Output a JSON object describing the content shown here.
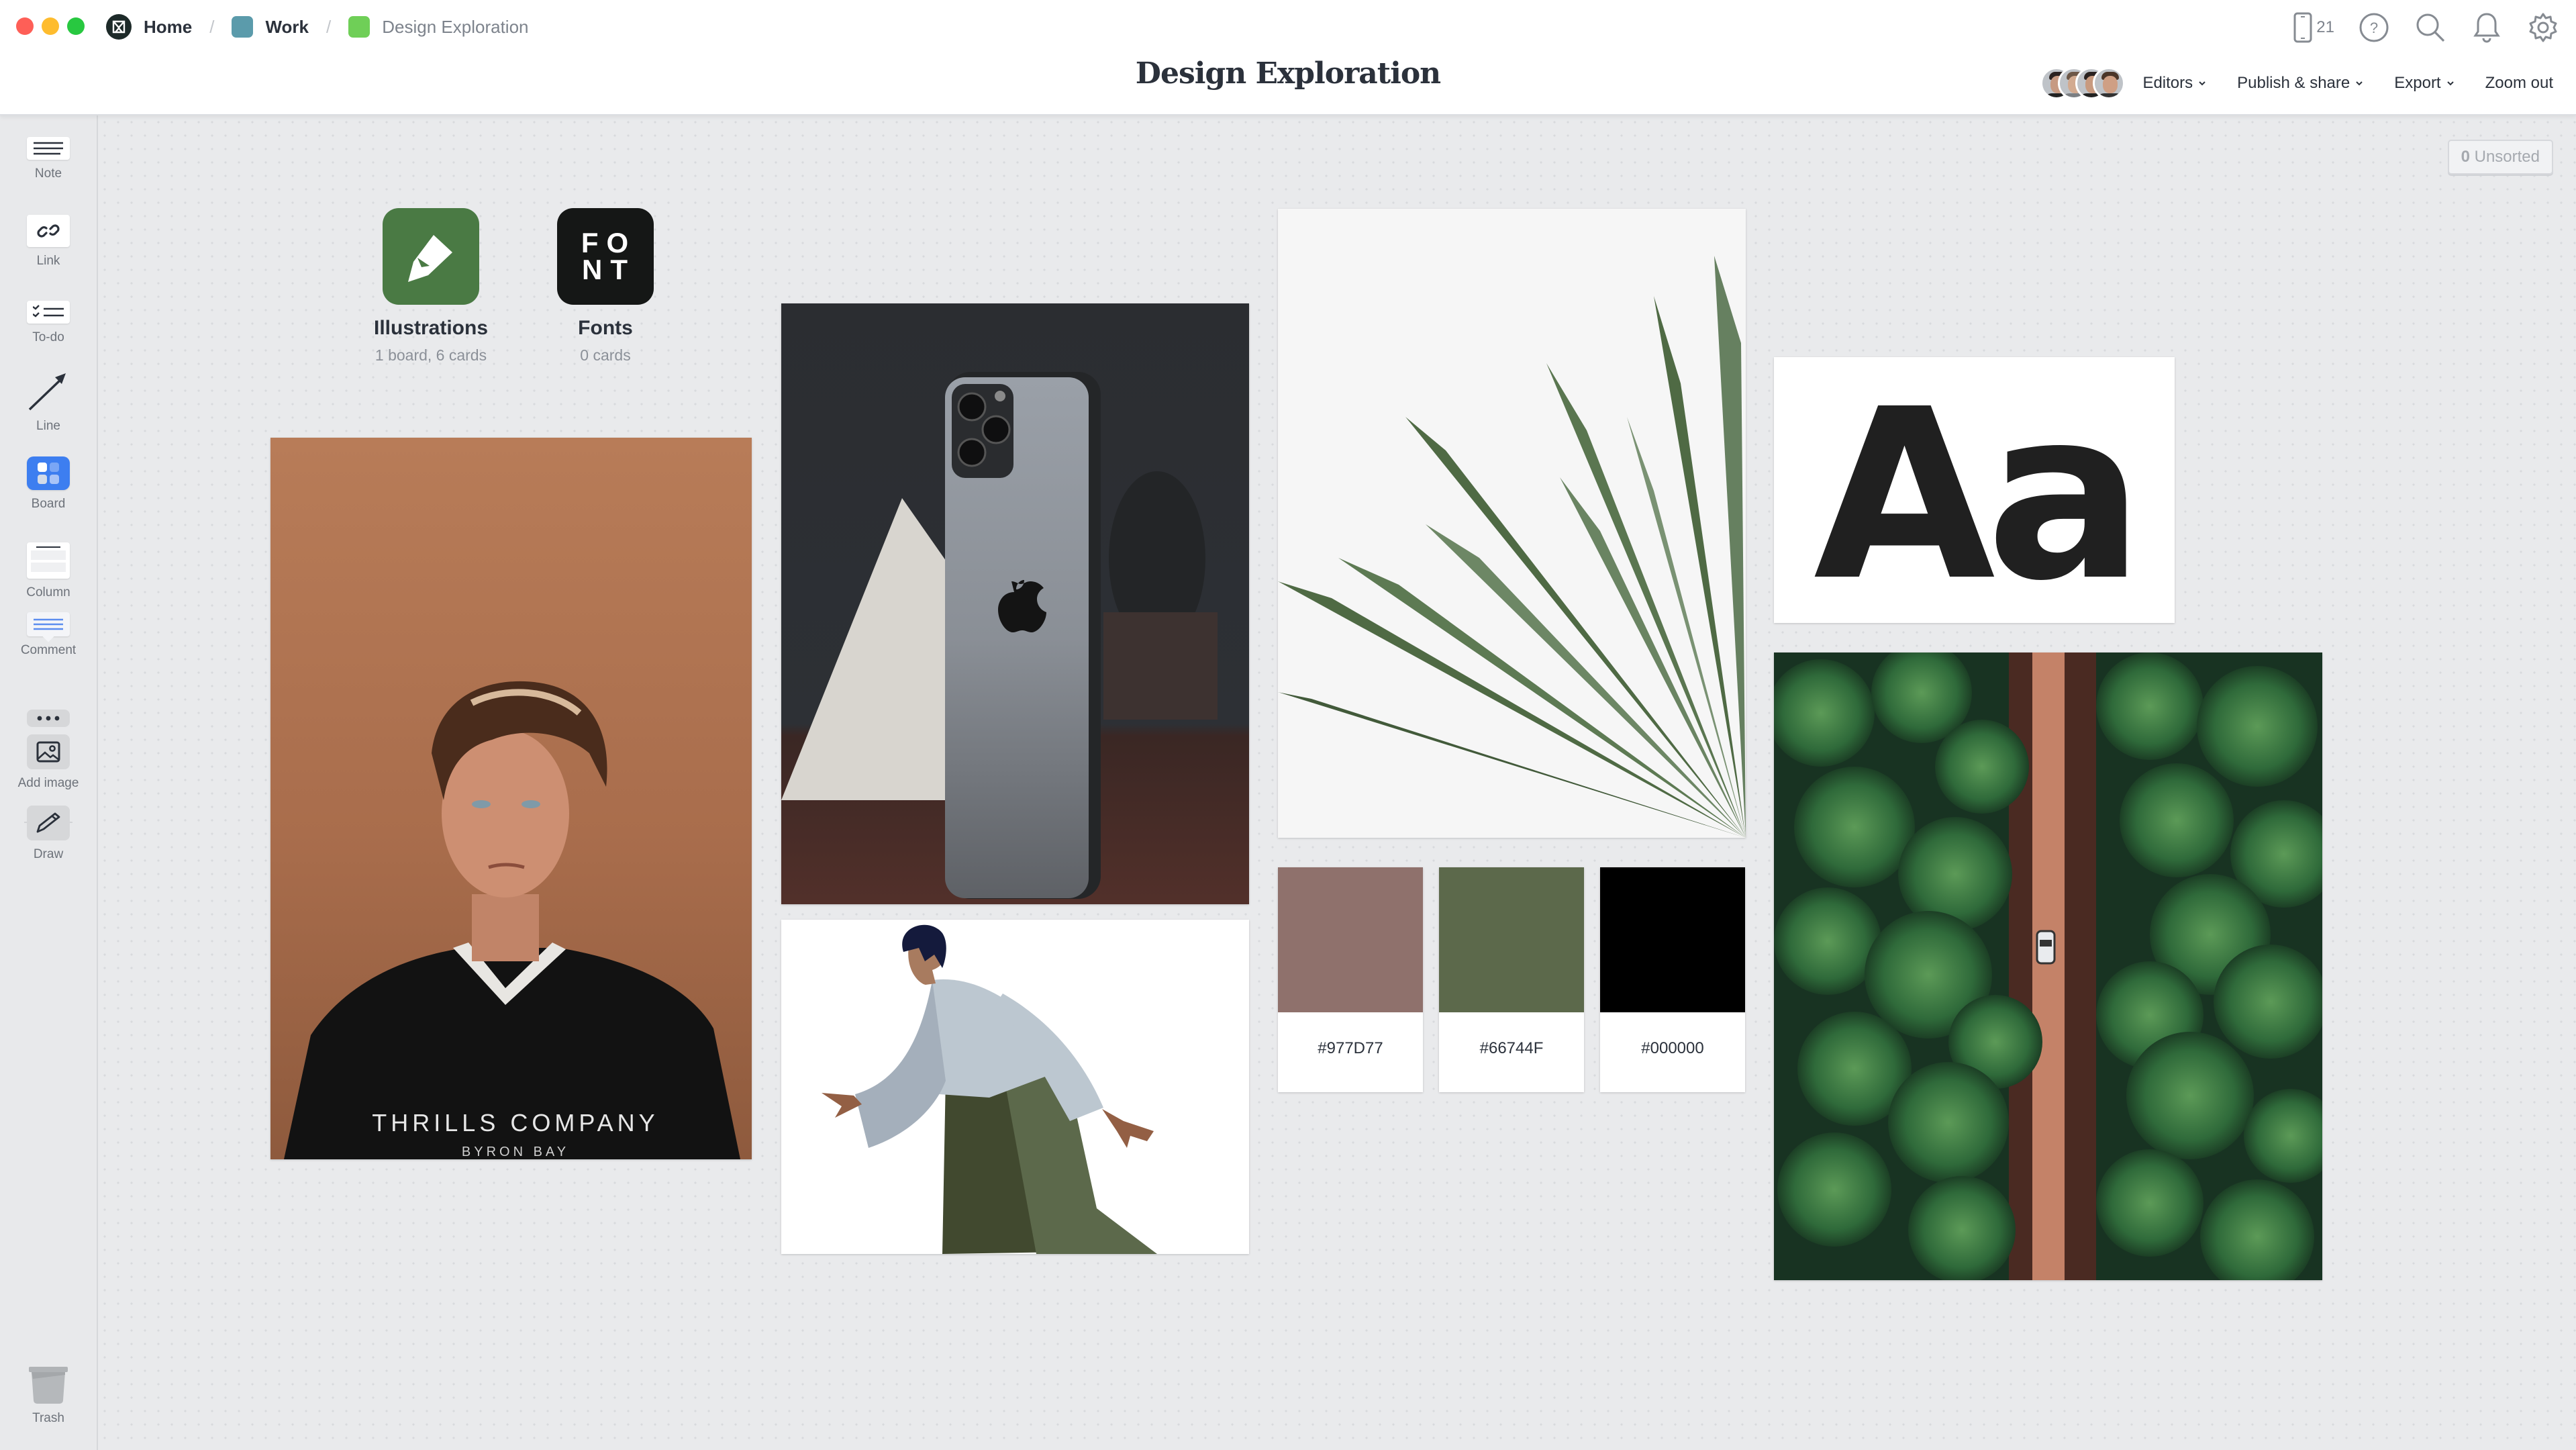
{
  "window": {
    "traffic_lights": {
      "close": "#fe5f57",
      "minimize": "#febc2e",
      "maximize": "#28c840"
    }
  },
  "breadcrumb": [
    {
      "label": "Home",
      "icon": "milanote-logo-icon",
      "color": "#1d2a29"
    },
    {
      "label": "Work",
      "icon": "board-square-icon",
      "color": "#5b9bab"
    },
    {
      "label": "Design Exploration",
      "icon": "board-square-icon",
      "color": "#6fcf57"
    }
  ],
  "header": {
    "title": "Design Exploration",
    "device_count": "21",
    "icons": [
      "mobile-device-icon",
      "help-icon",
      "search-icon",
      "bell-icon",
      "gear-icon"
    ],
    "editors_label": "Editors",
    "publish_label": "Publish & share",
    "export_label": "Export",
    "zoom_label": "Zoom out",
    "avatar_count": 4
  },
  "sidebar": {
    "tools": [
      {
        "label": "Note",
        "icon": "note-icon"
      },
      {
        "label": "Link",
        "icon": "link-icon"
      },
      {
        "label": "To-do",
        "icon": "todo-icon"
      },
      {
        "label": "Line",
        "icon": "line-arrow-icon"
      },
      {
        "label": "Board",
        "icon": "board-icon"
      },
      {
        "label": "Column",
        "icon": "column-icon"
      },
      {
        "label": "Comment",
        "icon": "comment-icon"
      },
      {
        "label": "",
        "icon": "more-icon"
      },
      {
        "label": "Add image",
        "icon": "image-icon"
      },
      {
        "label": "Draw",
        "icon": "pencil-icon"
      }
    ],
    "trash_label": "Trash",
    "board_color": "#3d7ef0"
  },
  "canvas": {
    "unsorted_count": "0",
    "unsorted_label": "Unsorted",
    "boards": [
      {
        "title": "Illustrations",
        "subtitle": "1 board, 6 cards",
        "color": "#4a7a44"
      },
      {
        "title": "Fonts",
        "subtitle": "0 cards",
        "color": "#151716",
        "icon_text_top": "FO",
        "icon_text_bottom": "NT"
      }
    ],
    "images": [
      {
        "name": "portrait-photo",
        "description": "Young man with swept hair against terracotta wall",
        "shirt_text": "THRILLS COMPANY",
        "shirt_subtext": "BYRON BAY"
      },
      {
        "name": "phone-photo",
        "description": "Graphite smartphone with triple camera beside concrete pyramid"
      },
      {
        "name": "walking-illustration",
        "description": "Flat illustration of a walking person"
      },
      {
        "name": "plant-photo",
        "description": "Green spiky plant leaves on white"
      },
      {
        "name": "forest-road-photo",
        "description": "Aerial view of car on dirt road through pine forest"
      }
    ],
    "swatches": [
      {
        "hex": "#977D77",
        "color": "#8f716c"
      },
      {
        "hex": "#66744F",
        "color": "#5c694b"
      },
      {
        "hex": "#000000",
        "color": "#000000"
      }
    ],
    "type_sample": "Aa"
  }
}
